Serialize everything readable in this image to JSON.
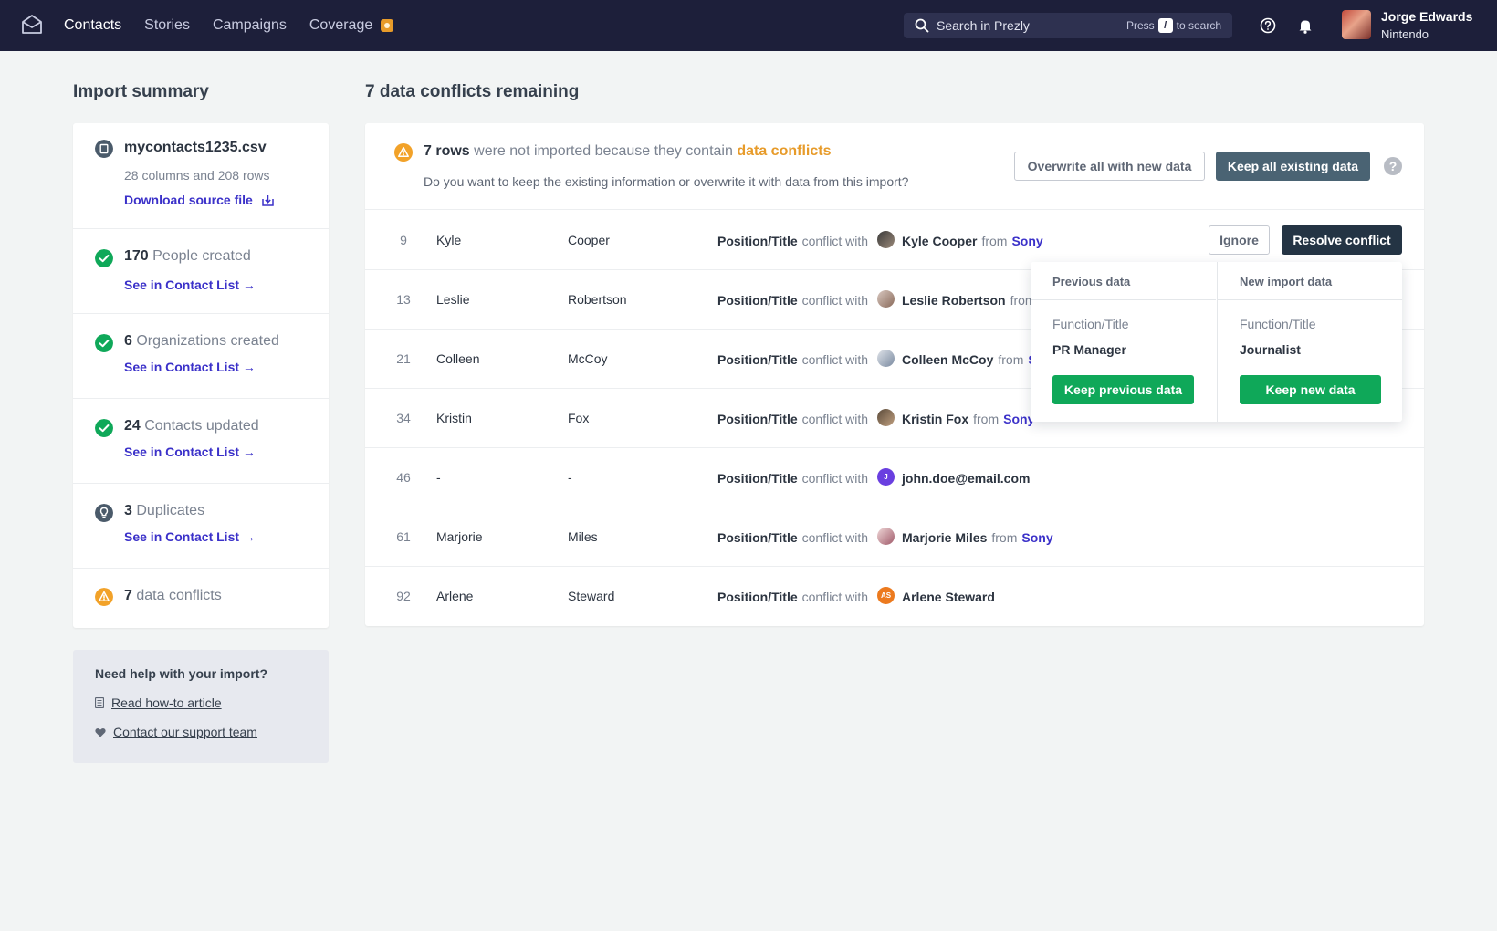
{
  "nav": {
    "items": [
      "Contacts",
      "Stories",
      "Campaigns",
      "Coverage"
    ]
  },
  "search": {
    "placeholder": "Search in Prezly",
    "hint_press": "Press",
    "hint_key": "/",
    "hint_suffix": "to search"
  },
  "user": {
    "name": "Jorge Edwards",
    "org": "Nintendo"
  },
  "summary": {
    "title": "Import summary",
    "file": {
      "name": "mycontacts1235.csv",
      "meta": "28 columns and 208 rows",
      "download_label": "Download source file"
    },
    "items": [
      {
        "count": "170",
        "label": "People created",
        "link": "See in Contact List →"
      },
      {
        "count": "6",
        "label": "Organizations created",
        "link": "See in Contact List →"
      },
      {
        "count": "24",
        "label": "Contacts updated",
        "link": "See in Contact List →"
      },
      {
        "count": "3",
        "label": "Duplicates",
        "link": "See in Contact List →"
      },
      {
        "count": "7",
        "label": "data conflicts"
      }
    ]
  },
  "help": {
    "title": "Need help with your import?",
    "article": "Read how-to article",
    "support": "Contact our support team"
  },
  "conflicts": {
    "title": "7 data conflicts remaining",
    "head_count": "7 rows",
    "head_mid": "were not imported because they contain",
    "head_emph": "data conflicts",
    "head_question": "Do you want to keep the existing information or overwrite it with data from this import?",
    "overwrite_label": "Overwrite all with new data",
    "keep_label": "Keep all existing data",
    "help_glyph": "?",
    "conflict_text": "conflict with",
    "from_text": "from",
    "ignore_label": "Ignore",
    "resolve_label": "Resolve conflict",
    "rows": [
      {
        "num": "9",
        "first": "Kyle",
        "last": "Cooper",
        "field": "Position/Title",
        "contact": "Kyle Cooper",
        "company": "Sony"
      },
      {
        "num": "13",
        "first": "Leslie",
        "last": "Robertson",
        "field": "Position/Title",
        "contact": "Leslie Robertson",
        "company": ""
      },
      {
        "num": "21",
        "first": "Colleen",
        "last": "McCoy",
        "field": "Position/Title",
        "contact": "Colleen McCoy",
        "company": "S"
      },
      {
        "num": "34",
        "first": "Kristin",
        "last": "Fox",
        "field": "Position/Title",
        "contact": "Kristin Fox",
        "company": "Sony"
      },
      {
        "num": "46",
        "first": "-",
        "last": "-",
        "field": "Position/Title",
        "contact": "john.doe@email.com",
        "company": "",
        "initials": "J"
      },
      {
        "num": "61",
        "first": "Marjorie",
        "last": "Miles",
        "field": "Position/Title",
        "contact": "Marjorie Miles",
        "company": "Sony"
      },
      {
        "num": "92",
        "first": "Arlene",
        "last": "Steward",
        "field": "Position/Title",
        "contact": "Arlene Steward",
        "company": "",
        "initials": "AS"
      }
    ]
  },
  "popover": {
    "previous_title": "Previous data",
    "new_title": "New import data",
    "field_label": "Function/Title",
    "previous_value": "PR Manager",
    "new_value": "Journalist",
    "keep_previous_label": "Keep previous data",
    "keep_new_label": "Keep new data"
  },
  "colors": {
    "topbar": "#1d1f3a",
    "link": "#3b31c9",
    "success": "#0fa859",
    "warning": "#e79b2a"
  },
  "icons": [
    "prezly-logo-icon",
    "search-icon",
    "help-circle-icon",
    "bell-icon",
    "file-icon",
    "download-icon",
    "check-circle-icon",
    "lightbulb-icon",
    "warning-icon",
    "book-icon",
    "heart-icon"
  ]
}
